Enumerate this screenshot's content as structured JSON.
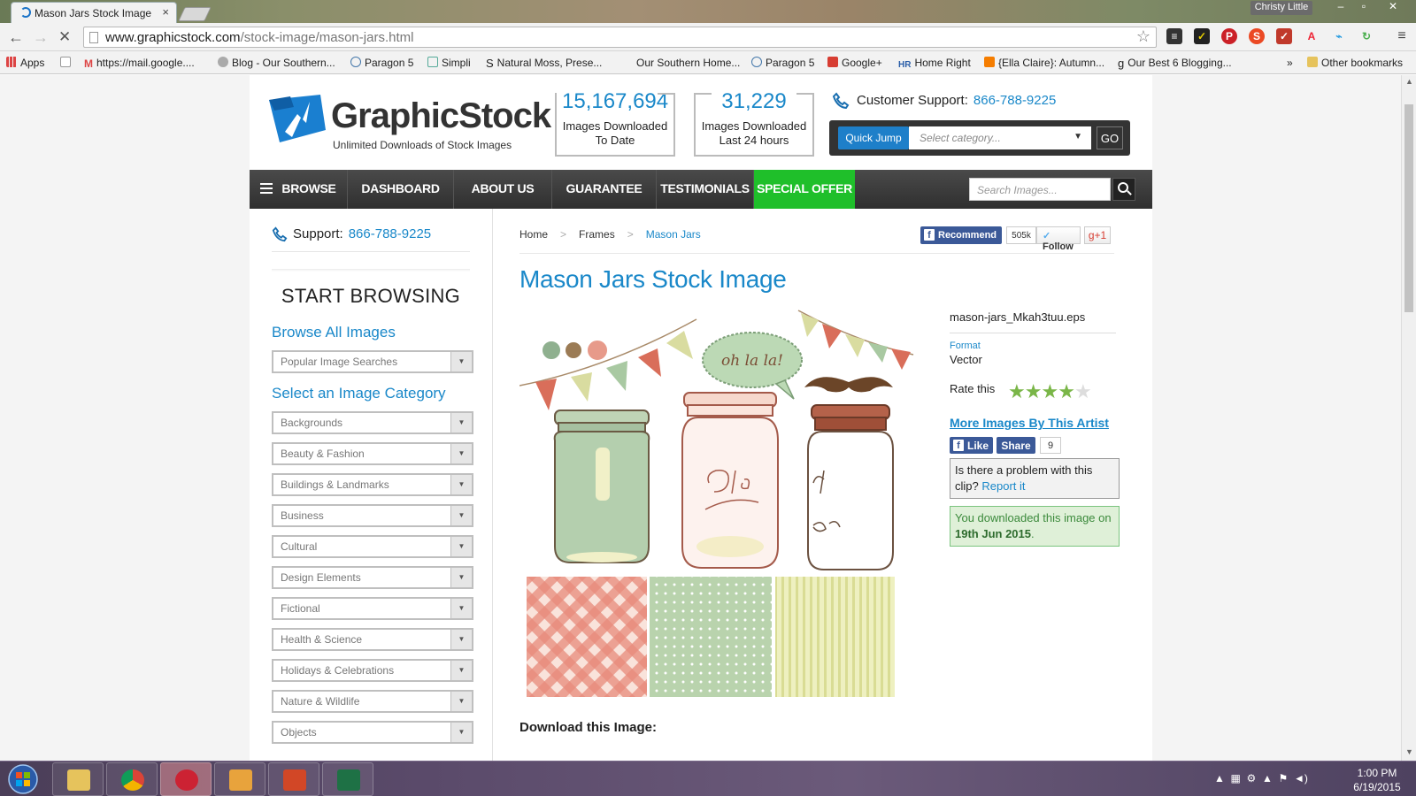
{
  "browser": {
    "tab_title": "Mason Jars Stock Image",
    "tab_close": "×",
    "user": "Christy Little",
    "window_buttons": [
      "–",
      "▫",
      "✕"
    ],
    "url_host": "www.graphicstock.com",
    "url_path": "/stock-image/mason-jars.html",
    "back": "←",
    "forward": "→",
    "stop": "✕",
    "star": "☆",
    "menu": "≡",
    "bookmarks": [
      "Apps",
      "https://mail.google....",
      "Blog - Our Southern...",
      "Paragon 5",
      "Simpli",
      "Natural Moss, Prese...",
      "Our Southern Home...",
      "Paragon 5",
      "Google+",
      "Home Right",
      "{Ella Claire}: Autumn...",
      "Our Best 6 Blogging..."
    ],
    "bookmarks_more": "»",
    "other_bookmarks": "Other bookmarks"
  },
  "site": {
    "logo_text": "GraphicStock",
    "logo_tagline": "Unlimited Downloads of Stock Images",
    "stats": [
      {
        "number": "15,167,694",
        "label_line1": "Images Downloaded",
        "label_line2": "To Date"
      },
      {
        "number": "31,229",
        "label_line1": "Images Downloaded",
        "label_line2": "Last 24 hours"
      }
    ],
    "customer_support_label": "Customer Support:",
    "customer_support_phone": "866-788-9225",
    "quick_jump": {
      "button": "Quick Jump",
      "placeholder": "Select category...",
      "caret": "▼",
      "go": "GO"
    },
    "nav": {
      "browse": "BROWSE",
      "dashboard": "DASHBOARD",
      "about": "ABOUT US",
      "guarantee": "GUARANTEE",
      "testimonials": "TESTIMONIALS",
      "special_offer": "SPECIAL OFFER",
      "search_placeholder": "Search Images..."
    },
    "colors": {
      "accent": "#1a88c9",
      "offer": "#1fbf2a",
      "nav_dark": "#333333"
    }
  },
  "sidebar": {
    "support_label": "Support:",
    "support_phone": "866-788-9225",
    "start_browsing": "START BROWSING",
    "browse_all": "Browse All Images",
    "popular_searches": "Popular Image Searches",
    "select_category": "Select an Image Category",
    "categories": [
      "Backgrounds",
      "Beauty & Fashion",
      "Buildings & Landmarks",
      "Business",
      "Cultural",
      "Design Elements",
      "Fictional",
      "Health & Science",
      "Holidays & Celebrations",
      "Nature & Wildlife",
      "Objects"
    ],
    "dropdown_arrow": "▼"
  },
  "main": {
    "breadcrumb": [
      "Home",
      "Frames",
      "Mason Jars"
    ],
    "breadcrumb_sep": ">",
    "social": {
      "recommend": "Recommend",
      "recommend_count": "505k",
      "follow": "Follow",
      "gplus": "g+1"
    },
    "title": "Mason Jars Stock Image",
    "art_bubble_text": "oh la la!",
    "file_name": "mason-jars_Mkah3tuu.eps",
    "format_label": "Format",
    "format_value": "Vector",
    "rate_label": "Rate this",
    "rating": 4,
    "rating_max": 5,
    "more_by_artist": "More Images By This Artist",
    "like": "Like",
    "share": "Share",
    "share_count": "9",
    "problem_text": "Is there a problem with this clip?",
    "report_link": "Report it",
    "downloaded_text": "You downloaded this image on",
    "downloaded_date": "19th Jun 2015",
    "downloaded_end": ".",
    "download_heading": "Download this Image:"
  },
  "taskbar": {
    "time": "1:00 PM",
    "date": "6/19/2015"
  }
}
